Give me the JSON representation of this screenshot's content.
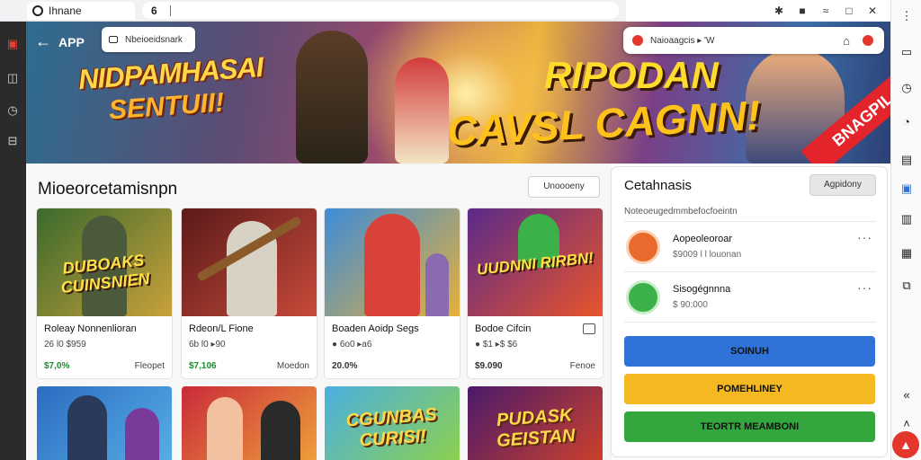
{
  "browser": {
    "tab_label": "Ihnane",
    "address_lock": "6"
  },
  "tray": [
    "✱",
    "■",
    "≈",
    "□",
    "✕"
  ],
  "banner": {
    "back_label": "APP",
    "search_text": "Nbeioeidsnark",
    "ad_text": "Naioaagcis ▸ 'W",
    "title_left_1": "NIDPAMHASAI",
    "title_left_2": "SENTUII!",
    "title_right_1": "RIPODAN",
    "title_right_2": "CAVSL CAGNN!",
    "ribbon": "BNAGPIL"
  },
  "section": {
    "title": "Mioeorcetamisnpn",
    "filter_label": "Unoooeny"
  },
  "cards": [
    {
      "art_text": "DUBOAKS CUINSNIEN",
      "name": "Roleay Nonnenlioran",
      "meta": "26 l0 $959",
      "price": "$7,0%",
      "action": "Fleopet",
      "colors": [
        "#3a6a2c",
        "#c9a13a"
      ]
    },
    {
      "art_text": "",
      "name": "Rdeon/L Fione",
      "meta": "6b l0 ▸90",
      "price": "$7,106",
      "action": "Moedon",
      "colors": [
        "#5c1a1a",
        "#c64a3a"
      ]
    },
    {
      "art_text": "",
      "name": "Boaden Aoidp Segs",
      "meta": "● 6o0 ▸a6",
      "price": "20.0%",
      "action": "",
      "colors": [
        "#3d8cd8",
        "#e6b03a"
      ]
    },
    {
      "art_text": "UUDNNI RIRBN!",
      "name": "Bodoe Cifcin",
      "meta": "● $1 ▸$ $6",
      "price": "$9.090",
      "action": "Fenoe",
      "colors": [
        "#5a2a8a",
        "#e9542a"
      ]
    }
  ],
  "cards_row2": [
    {
      "art_text": "",
      "colors": [
        "#2b6cc2",
        "#58b0e6"
      ]
    },
    {
      "art_text": "",
      "colors": [
        "#c92a3a",
        "#f0a23a"
      ]
    },
    {
      "art_text": "CGUNBAS CURISI!",
      "colors": [
        "#4ab0e0",
        "#8fd14a"
      ]
    },
    {
      "art_text": "PUDASK GEISTAN",
      "colors": [
        "#4a1a6a",
        "#d0422a"
      ]
    }
  ],
  "panel": {
    "title": "Cetahnasis",
    "button_label": "Agpidony",
    "subtitle": "Noteoeugedmmbefocfoeintn",
    "entries": [
      {
        "name": "Aopeoleoroar",
        "meta": "$9009 l l louonan",
        "avatar_color": "#e86a2c"
      },
      {
        "name": "Sisogégnnna",
        "meta": "$ 90:000",
        "avatar_color": "#3cb14a"
      }
    ],
    "buttons": [
      {
        "label": "SOINUH",
        "color": "#2f73d8"
      },
      {
        "label": "POMEHLINEY",
        "color": "#f4b820"
      },
      {
        "label": "TEORTR MEAMBONI",
        "color": "#33a63d"
      }
    ]
  }
}
